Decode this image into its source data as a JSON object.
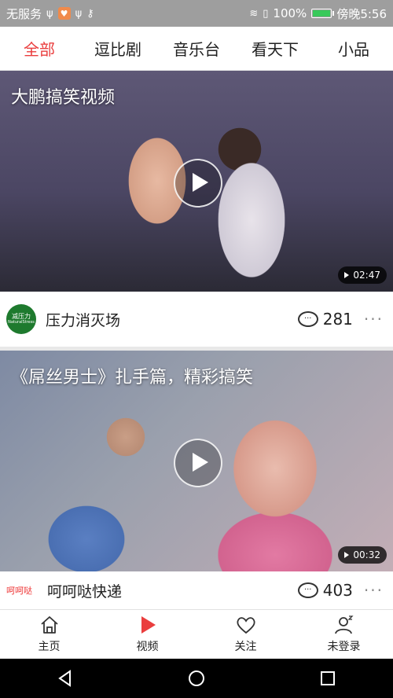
{
  "status_bar": {
    "carrier": "无服务",
    "battery_percent": "100%",
    "battery_level": 1.0,
    "time_label": "傍晚5:56"
  },
  "tabs": [
    {
      "label": "全部",
      "active": true
    },
    {
      "label": "逗比剧",
      "active": false
    },
    {
      "label": "音乐台",
      "active": false
    },
    {
      "label": "看天下",
      "active": false
    },
    {
      "label": "小品",
      "active": false
    }
  ],
  "feed": [
    {
      "title": "大鹏搞笑视频",
      "duration": "02:47",
      "channel_logo_text": "减压力",
      "channel_logo_sub": "NaturalStress",
      "channel": "压力消灭场",
      "comments": "281"
    },
    {
      "title": "《屌丝男士》扎手篇，精彩搞笑",
      "duration": "00:32",
      "channel_logo_text": "呵呵哒",
      "channel": "呵呵哒快递",
      "comments": "403"
    }
  ],
  "bottom_nav": [
    {
      "label": "主页",
      "icon": "home-icon",
      "active": false
    },
    {
      "label": "视频",
      "icon": "play-icon",
      "active": true
    },
    {
      "label": "关注",
      "icon": "heart-icon",
      "active": false
    },
    {
      "label": "未登录",
      "icon": "user-icon",
      "active": false
    }
  ],
  "colors": {
    "accent": "#ea3e3e",
    "status_bar": "#9e9e9e",
    "battery_fill": "#38c95a"
  }
}
